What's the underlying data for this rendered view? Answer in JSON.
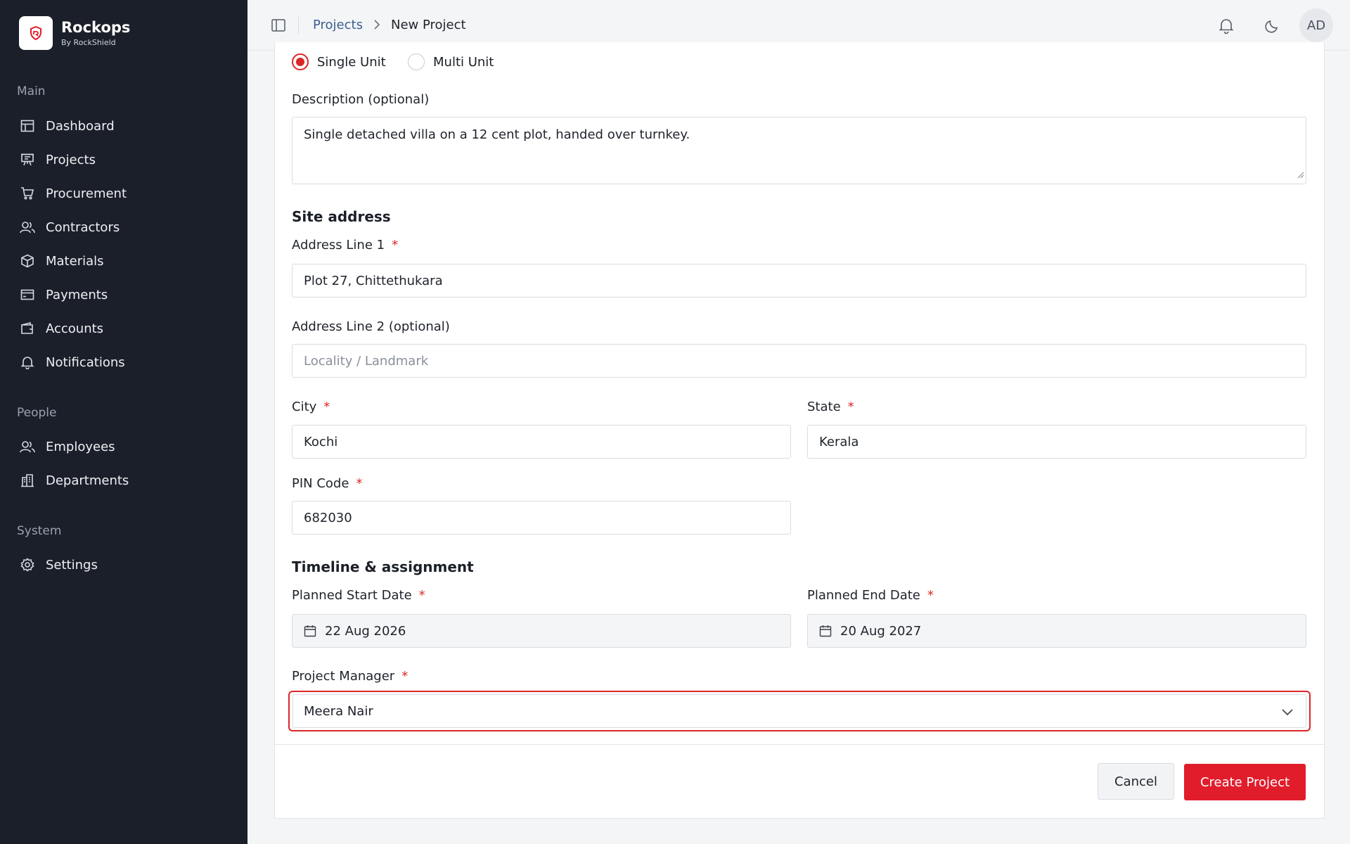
{
  "brand": {
    "name": "Rockops",
    "subtitle": "By RockShield"
  },
  "sidebar": {
    "sections": [
      {
        "title": "Main"
      },
      {
        "title": "People"
      },
      {
        "title": "System"
      }
    ],
    "items": [
      {
        "label": "Dashboard",
        "icon": "dashboard-icon"
      },
      {
        "label": "Projects",
        "icon": "projects-icon"
      },
      {
        "label": "Procurement",
        "icon": "cart-icon"
      },
      {
        "label": "Contractors",
        "icon": "users-icon"
      },
      {
        "label": "Materials",
        "icon": "box-icon"
      },
      {
        "label": "Payments",
        "icon": "card-icon"
      },
      {
        "label": "Accounts",
        "icon": "wallet-icon"
      },
      {
        "label": "Notifications",
        "icon": "bell-icon"
      },
      {
        "label": "Employees",
        "icon": "users-icon"
      },
      {
        "label": "Departments",
        "icon": "building-icon"
      },
      {
        "label": "Settings",
        "icon": "gear-icon"
      }
    ]
  },
  "header": {
    "breadcrumb_parent": "Projects",
    "breadcrumb_current": "New Project",
    "avatar_initials": "AD"
  },
  "form": {
    "unit_type": {
      "options": [
        "Single Unit",
        "Multi Unit"
      ],
      "selected": "Single Unit"
    },
    "description": {
      "label": "Description (optional)",
      "value": "Single detached villa on a 12 cent plot, handed over turnkey."
    },
    "site_address_title": "Site address",
    "address_line1": {
      "label": "Address Line 1",
      "required": "*",
      "value": "Plot 27, Chittethukara"
    },
    "address_line2": {
      "label": "Address Line 2 (optional)",
      "placeholder": "Locality / Landmark"
    },
    "city": {
      "label": "City",
      "required": "*",
      "value": "Kochi"
    },
    "state": {
      "label": "State",
      "required": "*",
      "value": "Kerala"
    },
    "pin": {
      "label": "PIN Code",
      "required": "*",
      "value": "682030"
    },
    "timeline_title": "Timeline & assignment",
    "start_date": {
      "label": "Planned Start Date",
      "required": "*",
      "value": "22 Aug 2026"
    },
    "end_date": {
      "label": "Planned End Date",
      "required": "*",
      "value": "20 Aug 2027"
    },
    "manager": {
      "label": "Project Manager",
      "required": "*",
      "value": "Meera Nair"
    }
  },
  "actions": {
    "cancel": "Cancel",
    "create": "Create Project"
  },
  "colors": {
    "accent": "#e11d2b",
    "sidebar_bg": "#1b1f29",
    "link": "#3b5f8c"
  }
}
